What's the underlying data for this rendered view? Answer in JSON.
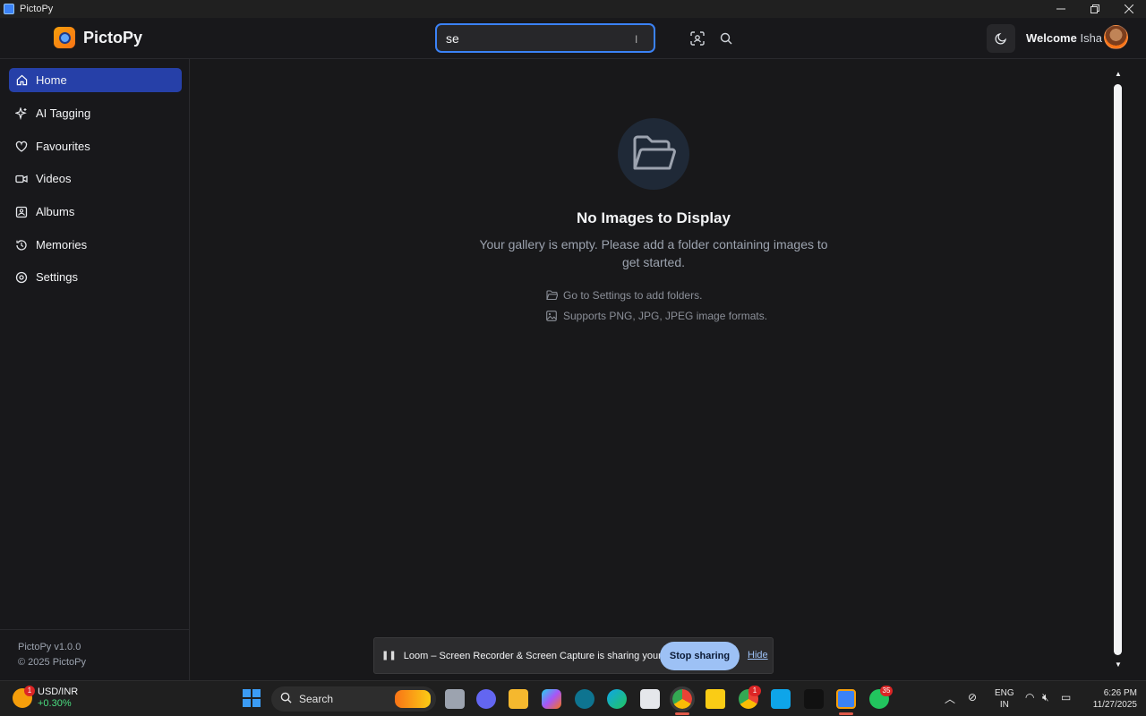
{
  "window": {
    "title": "PictoPy"
  },
  "header": {
    "brand": "PictoPy",
    "search_value": "se",
    "welcome_prefix": "Welcome",
    "user_name": "Isha"
  },
  "sidebar": {
    "items": [
      {
        "label": "Home",
        "icon": "home-icon",
        "active": true
      },
      {
        "label": "AI Tagging",
        "icon": "sparkles-icon"
      },
      {
        "label": "Favourites",
        "icon": "heart-icon"
      },
      {
        "label": "Videos",
        "icon": "video-icon"
      },
      {
        "label": "Albums",
        "icon": "album-icon"
      },
      {
        "label": "Memories",
        "icon": "history-icon"
      },
      {
        "label": "Settings",
        "icon": "settings-icon"
      }
    ],
    "version": "PictoPy v1.0.0",
    "copyright": "© 2025 PictoPy"
  },
  "main": {
    "empty_title": "No Images to Display",
    "empty_desc": "Your gallery is empty. Please add a folder containing images to get started.",
    "hint_folders": "Go to Settings to add folders.",
    "hint_formats": "Supports PNG, JPG, JPEG image formats."
  },
  "loom": {
    "message": "Loom – Screen Recorder & Screen Capture is sharing your screen.",
    "stop_label": "Stop sharing",
    "hide_label": "Hide"
  },
  "taskbar": {
    "widget_title": "USD/INR",
    "widget_change": "+0.30%",
    "widget_badge": "1",
    "search_label": "Search",
    "teams_badge": "1",
    "whatsapp_badge": "35",
    "lang_line1": "ENG",
    "lang_line2": "IN",
    "time": "6:26 PM",
    "date": "11/27/2025"
  },
  "colors": {
    "accent": "#3b82f6",
    "active_nav": "#2640a8",
    "background": "#18181a"
  }
}
